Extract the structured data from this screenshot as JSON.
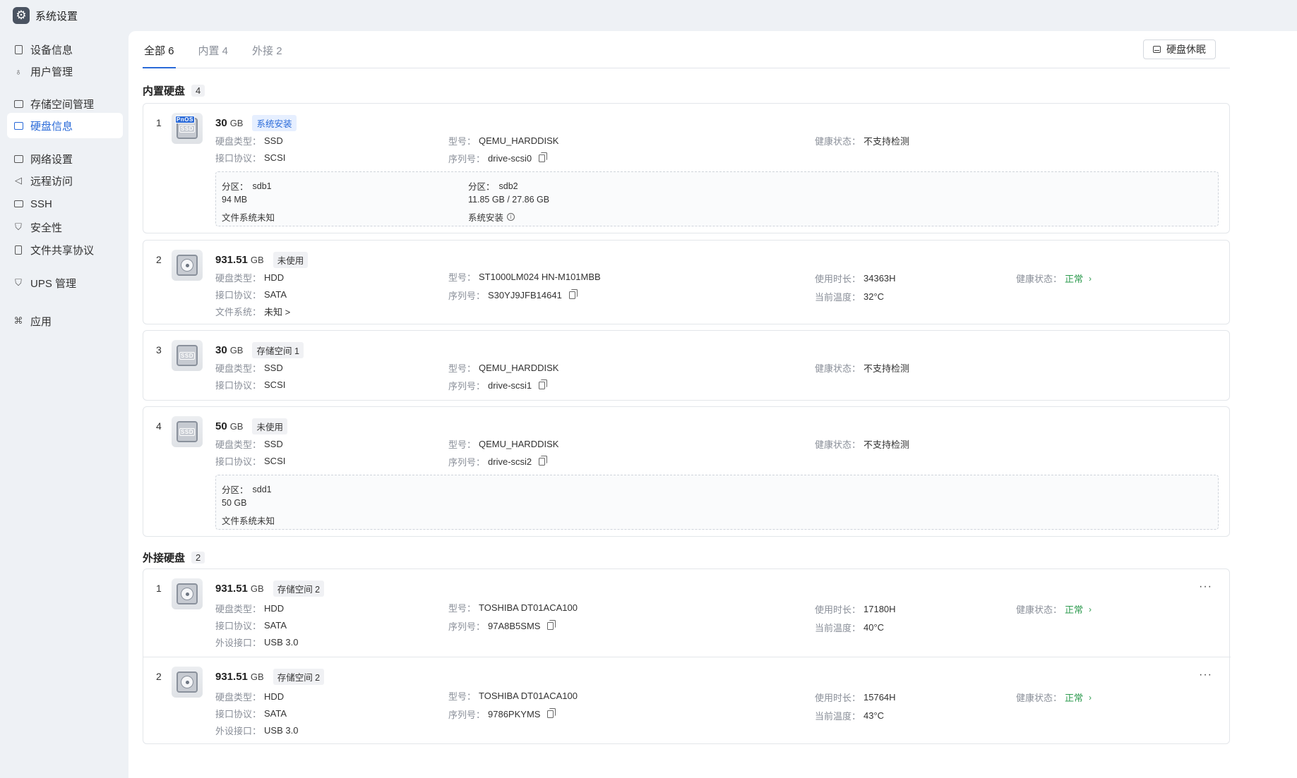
{
  "app": {
    "title": "系统设置"
  },
  "sidebar": {
    "items": [
      {
        "label": "设备信息"
      },
      {
        "label": "用户管理"
      },
      {
        "label": "存储空间管理"
      },
      {
        "label": "硬盘信息"
      },
      {
        "label": "网络设置"
      },
      {
        "label": "远程访问"
      },
      {
        "label": "SSH"
      },
      {
        "label": "安全性"
      },
      {
        "label": "文件共享协议"
      },
      {
        "label": "UPS 管理"
      },
      {
        "label": "应用"
      }
    ],
    "active": "硬盘信息"
  },
  "tabs": [
    {
      "label": "全部 6"
    },
    {
      "label": "内置 4"
    },
    {
      "label": "外接 2"
    }
  ],
  "toolbar": {
    "sleep_label": "硬盘休眠"
  },
  "internal": {
    "title": "内置硬盘",
    "count": "4",
    "disks": [
      {
        "index": "1",
        "capacity": "30",
        "unit": "GB",
        "tag": "系统安装",
        "boot_badge": "PnOS",
        "type_k": "硬盘类型：",
        "type_v": "SSD",
        "proto_k": "接口协议：",
        "proto_v": "SCSI",
        "model_k": "型号：",
        "model_v": "QEMU_HARDDISK",
        "serial_k": "序列号：",
        "serial_v": "drive-scsi0",
        "health_k": "健康状态：",
        "health_v": "不支持检测",
        "partitions": [
          {
            "name_k": "分区：",
            "name_v": "sdb1",
            "size": "94 MB",
            "fs": "文件系统未知"
          },
          {
            "name_k": "分区：",
            "name_v": "sdb2",
            "size": "11.85 GB / 27.86 GB",
            "fs": "系统安装"
          }
        ]
      },
      {
        "index": "2",
        "capacity": "931.51",
        "unit": "GB",
        "tag": "未使用",
        "type_k": "硬盘类型：",
        "type_v": "HDD",
        "proto_k": "接口协议：",
        "proto_v": "SATA",
        "fs_k": "文件系统：",
        "fs_v": "未知 >",
        "model_k": "型号：",
        "model_v": "ST1000LM024 HN-M101MBB",
        "serial_k": "序列号：",
        "serial_v": "S30YJ9JFB14641",
        "hours_k": "使用时长：",
        "hours_v": "34363H",
        "temp_k": "当前温度：",
        "temp_v": "32°C",
        "health_k": "健康状态：",
        "health_v": "正常"
      },
      {
        "index": "3",
        "capacity": "30",
        "unit": "GB",
        "tag": "存储空间 1",
        "type_k": "硬盘类型：",
        "type_v": "SSD",
        "proto_k": "接口协议：",
        "proto_v": "SCSI",
        "model_k": "型号：",
        "model_v": "QEMU_HARDDISK",
        "serial_k": "序列号：",
        "serial_v": "drive-scsi1",
        "health_k": "健康状态：",
        "health_v": "不支持检测"
      },
      {
        "index": "4",
        "capacity": "50",
        "unit": "GB",
        "tag": "未使用",
        "type_k": "硬盘类型：",
        "type_v": "SSD",
        "proto_k": "接口协议：",
        "proto_v": "SCSI",
        "model_k": "型号：",
        "model_v": "QEMU_HARDDISK",
        "serial_k": "序列号：",
        "serial_v": "drive-scsi2",
        "health_k": "健康状态：",
        "health_v": "不支持检测",
        "partitions": [
          {
            "name_k": "分区：",
            "name_v": "sdd1",
            "size": "50 GB",
            "fs": "文件系统未知"
          }
        ]
      }
    ]
  },
  "external": {
    "title": "外接硬盘",
    "count": "2",
    "disks": [
      {
        "index": "1",
        "capacity": "931.51",
        "unit": "GB",
        "tag": "存储空间 2",
        "type_k": "硬盘类型：",
        "type_v": "HDD",
        "proto_k": "接口协议：",
        "proto_v": "SATA",
        "port_k": "外设接口：",
        "port_v": "USB 3.0",
        "model_k": "型号：",
        "model_v": "TOSHIBA DT01ACA100",
        "serial_k": "序列号：",
        "serial_v": "97A8B5SMS",
        "hours_k": "使用时长：",
        "hours_v": "17180H",
        "temp_k": "当前温度：",
        "temp_v": "40°C",
        "health_k": "健康状态：",
        "health_v": "正常"
      },
      {
        "index": "2",
        "capacity": "931.51",
        "unit": "GB",
        "tag": "存储空间 2",
        "type_k": "硬盘类型：",
        "type_v": "HDD",
        "proto_k": "接口协议：",
        "proto_v": "SATA",
        "port_k": "外设接口：",
        "port_v": "USB 3.0",
        "model_k": "型号：",
        "model_v": "TOSHIBA DT01ACA100",
        "serial_k": "序列号：",
        "serial_v": "9786PKYMS",
        "hours_k": "使用时长：",
        "hours_v": "15764H",
        "temp_k": "当前温度：",
        "temp_v": "43°C",
        "health_k": "健康状态：",
        "health_v": "正常"
      }
    ]
  },
  "colors": {
    "accent": "#2a6ad8",
    "ok": "#2e9b4f"
  },
  "icons": [
    "gear-icon",
    "device-icon",
    "user-icon",
    "storage-icon",
    "disk-icon",
    "network-icon",
    "send-icon",
    "terminal-icon",
    "shield-icon",
    "document-icon",
    "ups-icon",
    "apps-icon",
    "copy-icon",
    "info-icon",
    "more-icon",
    "chevron-right-icon"
  ]
}
